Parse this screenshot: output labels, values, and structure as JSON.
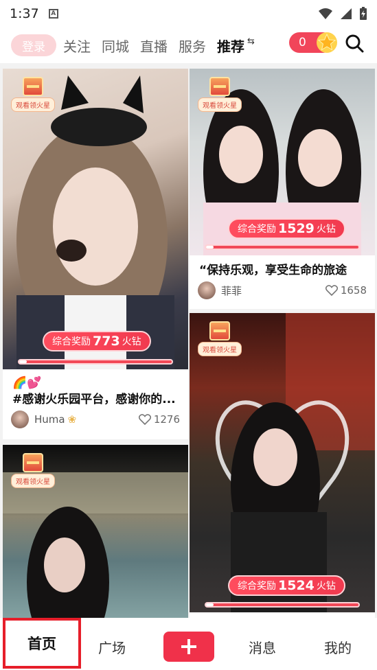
{
  "status_bar": {
    "time": "1:37",
    "notification_letter": "A"
  },
  "top_nav": {
    "login": "登录",
    "tabs": [
      "关注",
      "同城",
      "直播",
      "服务"
    ],
    "active_tab": "推荐",
    "active_tab_icon": "⇆",
    "coins": "0"
  },
  "badge_label": "观看领火星",
  "cards": [
    {
      "reward_prefix": "综合奖励",
      "reward_value": "773",
      "reward_suffix": "火钻",
      "progress": 0.05,
      "emoji": "🌈💕",
      "title": "#感谢火乐园平台，感谢你的...",
      "author": "Huma",
      "author_badge": "❀",
      "likes": "1276"
    },
    {
      "reward_prefix": "综合奖励",
      "reward_value": "1529",
      "reward_suffix": "火钻",
      "progress": 0.05,
      "title": "“保持乐观，享受生命的旅途",
      "author": "菲菲",
      "likes": "1658"
    },
    {
      "reward_prefix": "综合奖励",
      "reward_value": "1524",
      "reward_suffix": "火钻",
      "progress": 0.05
    },
    {}
  ],
  "bottom_bar": {
    "home": "首页",
    "square": "广场",
    "messages": "消息",
    "profile": "我的"
  },
  "colors": {
    "accent": "#f0314a",
    "highlight_box": "#e61e2a"
  }
}
